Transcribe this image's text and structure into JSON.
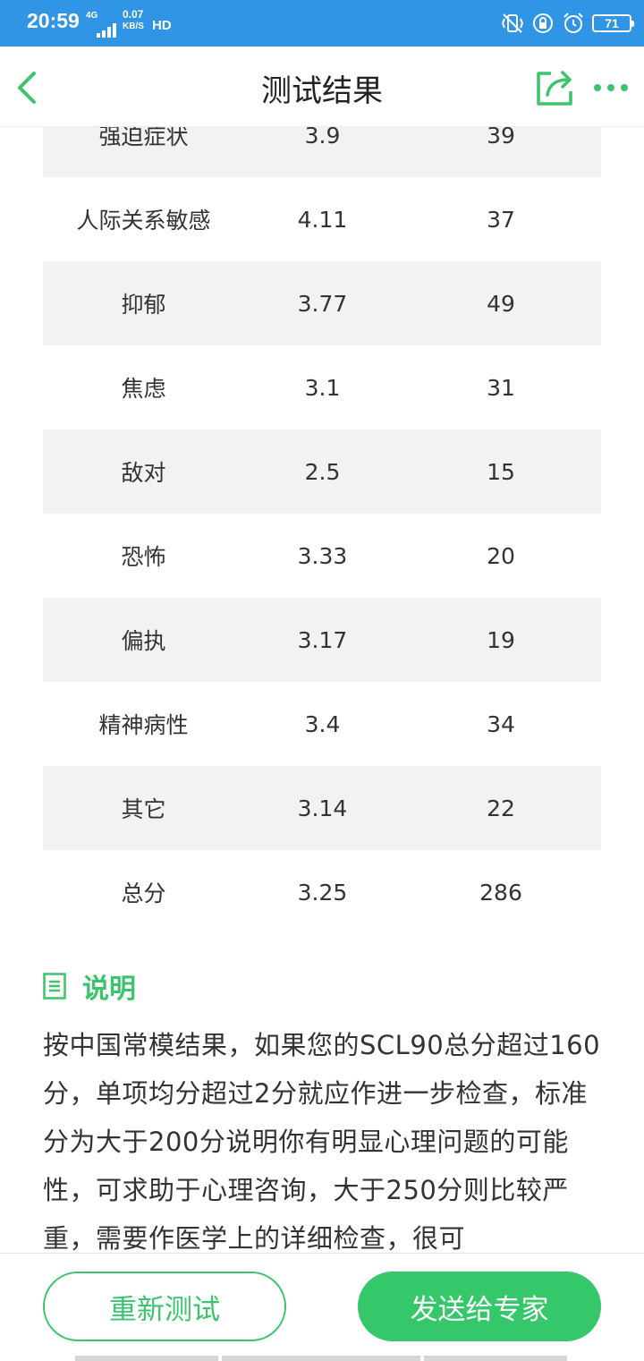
{
  "status_bar": {
    "time": "20:59",
    "network": "4G",
    "speed_value": "0.07",
    "speed_unit": "KB/S",
    "hd": "HD",
    "battery": "71"
  },
  "nav": {
    "title": "测试结果"
  },
  "table": {
    "rows": [
      {
        "name": "强迫症状",
        "avg": "3.9",
        "total": "39"
      },
      {
        "name": "人际关系敏感",
        "avg": "4.11",
        "total": "37"
      },
      {
        "name": "抑郁",
        "avg": "3.77",
        "total": "49"
      },
      {
        "name": "焦虑",
        "avg": "3.1",
        "total": "31"
      },
      {
        "name": "敌对",
        "avg": "2.5",
        "total": "15"
      },
      {
        "name": "恐怖",
        "avg": "3.33",
        "total": "20"
      },
      {
        "name": "偏执",
        "avg": "3.17",
        "total": "19"
      },
      {
        "name": "精神病性",
        "avg": "3.4",
        "total": "34"
      },
      {
        "name": "其它",
        "avg": "3.14",
        "total": "22"
      },
      {
        "name": "总分",
        "avg": "3.25",
        "total": "286"
      }
    ]
  },
  "description": {
    "title": "说明",
    "text": "按中国常模结果，如果您的SCL90总分超过160分，单项均分超过2分就应作进一步检查，标准分为大于200分说明你有明显心理问题的可能性，可求助于心理咨询，大于250分则比较严重，需要作医学上的详细检查，很可"
  },
  "actions": {
    "retest_label": "重新测试",
    "send_label": "发送给专家"
  },
  "colors": {
    "status_bar": "#2f95e4",
    "accent_green": "#3ac46b",
    "row_shade": "#f2f2f2"
  }
}
